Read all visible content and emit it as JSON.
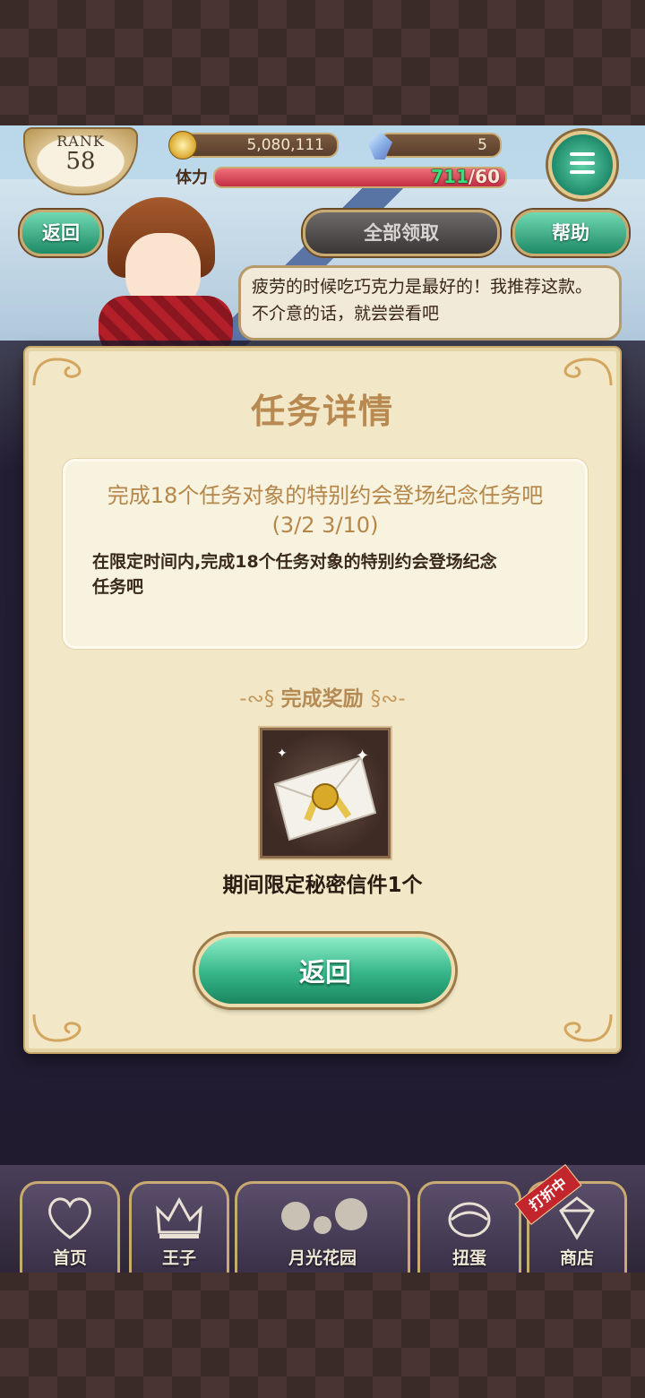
{
  "hud": {
    "rank_label": "RANK",
    "rank_value": "58",
    "coins": "5,080,111",
    "gems": "5",
    "stamina_label": "体力",
    "stamina_current": "711",
    "stamina_max": "/60"
  },
  "header": {
    "back_label": "返回",
    "claim_all_label": "全部领取",
    "help_label": "帮助"
  },
  "speech": {
    "text": "疲劳的时候吃巧克力是最好的！我推荐这款。不介意的话，就尝尝看吧"
  },
  "modal": {
    "title": "任务详情",
    "task_title": "完成18个任务对象的特别约会登场纪念任务吧(3/2 3/10)",
    "task_description": "在限定时间内,完成18个任务对象的特别约会登场纪念任务吧",
    "reward_heading": "完成奖励",
    "reward_name": "期间限定秘密信件1个",
    "return_label": "返回"
  },
  "nav": {
    "items": [
      {
        "label": "首页",
        "icon": "heart-icon"
      },
      {
        "label": "王子",
        "icon": "crown-icon"
      },
      {
        "label": "月光花园",
        "icon": "garden-icon"
      },
      {
        "label": "扭蛋",
        "icon": "gacha-icon"
      },
      {
        "label": "商店",
        "icon": "shop-icon"
      }
    ],
    "sale_badge": "打折中"
  },
  "colors": {
    "accent_green": "#35b588",
    "title_gold": "#b88a52",
    "modal_bg": "#f2e8c7",
    "stamina_green": "#37e07a"
  }
}
